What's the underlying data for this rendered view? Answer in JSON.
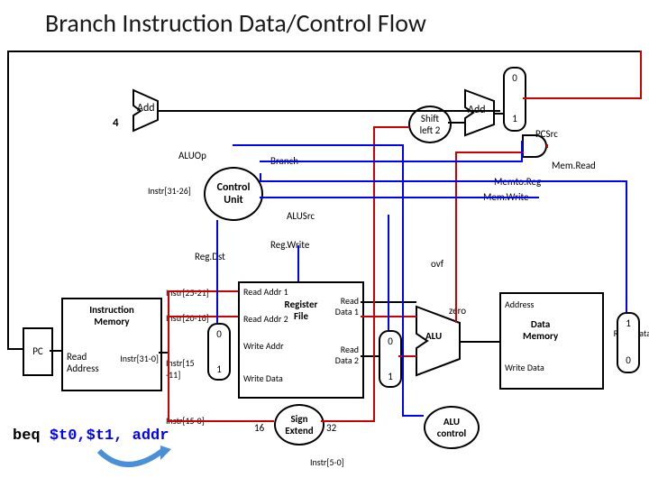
{
  "title": "Branch Instruction Data/Control Flow",
  "pc": "PC",
  "instr_mem": {
    "title": "Instruction\nMemory",
    "ra": "Read\nAddress",
    "out": "Instr[31-0]"
  },
  "reg_file": {
    "title": "Register\nFile",
    "ra1": "Read Addr 1",
    "ra2": "Read Addr 2",
    "wa": "Write Addr",
    "wd": "Write Data",
    "rd1": "Read\nData 1",
    "rd2": "Read\nData 2"
  },
  "data_mem": {
    "title": "Data\nMemory",
    "addr": "Address",
    "wd": "Write Data",
    "rd": "Read Data"
  },
  "control": "Control\nUnit",
  "alu_control": "ALU\ncontrol",
  "sign_extend": "Sign\nExtend",
  "alu": "ALU",
  "add1": "Add",
  "add2": "Add",
  "shift": "Shift\nleft 2",
  "signals": {
    "aluop": "ALUOp",
    "branch": "Branch",
    "alusrc": "ALUSrc",
    "regwrite": "Reg.Write",
    "regdst": "Reg.Dst",
    "memtoreg": "Memto.Reg",
    "memwrite": "Mem.Write",
    "memread": "Mem.Read",
    "pcsrc": "PCSrc",
    "ovf": "ovf",
    "zero": "zero"
  },
  "bits": {
    "i25_21": "Instr[25-21]",
    "i20_16": "Instr[20-16]",
    "i15_11": "Instr[15\n-11]",
    "i15_0": "Instr[15-0]",
    "i5_0": "Instr[5-0]",
    "i31_26": "Instr[31-26]"
  },
  "nums": {
    "four": "4",
    "sixteen": "16",
    "thirtytwo": "32",
    "m0": "0",
    "m1": "1"
  },
  "code": {
    "op": "beq ",
    "args": "$t0,$t1, addr"
  }
}
